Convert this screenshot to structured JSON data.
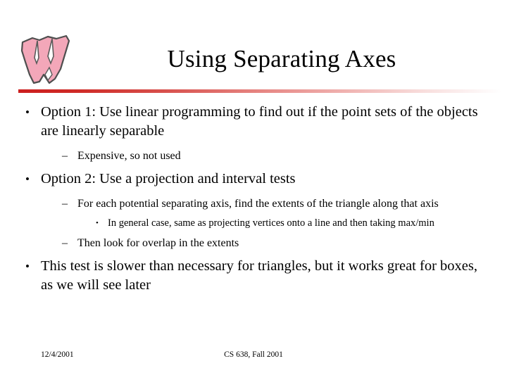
{
  "slide": {
    "title": "Using Separating Axes",
    "logo_alt": "wisconsin-w-logo",
    "bullets": [
      {
        "level": 1,
        "glyph": "•",
        "text": "Option 1: Use linear programming to find out if the point sets of the objects are linearly separable"
      },
      {
        "level": 2,
        "glyph": "–",
        "text": "Expensive, so not used"
      },
      {
        "level": 1,
        "glyph": "•",
        "text": "Option 2: Use a projection and interval tests"
      },
      {
        "level": 2,
        "glyph": "–",
        "text": "For each potential separating axis, find the extents of the triangle along that axis"
      },
      {
        "level": 3,
        "glyph": "•",
        "text": "In general case, same as projecting vertices onto a line and then taking max/min"
      },
      {
        "level": 2,
        "glyph": "–",
        "text": "Then look for overlap in the extents"
      },
      {
        "level": 1,
        "glyph": "•",
        "text": "This test is slower than necessary for triangles, but it works great for boxes, as we will see later"
      }
    ],
    "footer": {
      "date": "12/4/2001",
      "course": "CS 638, Fall 2001"
    },
    "colors": {
      "divider_start": "#cc1f1f",
      "divider_end": "#ffffff",
      "logo_fill": "#f4a6b8",
      "logo_outline": "#4a4a4a",
      "text": "#000000",
      "background": "#ffffff"
    }
  }
}
